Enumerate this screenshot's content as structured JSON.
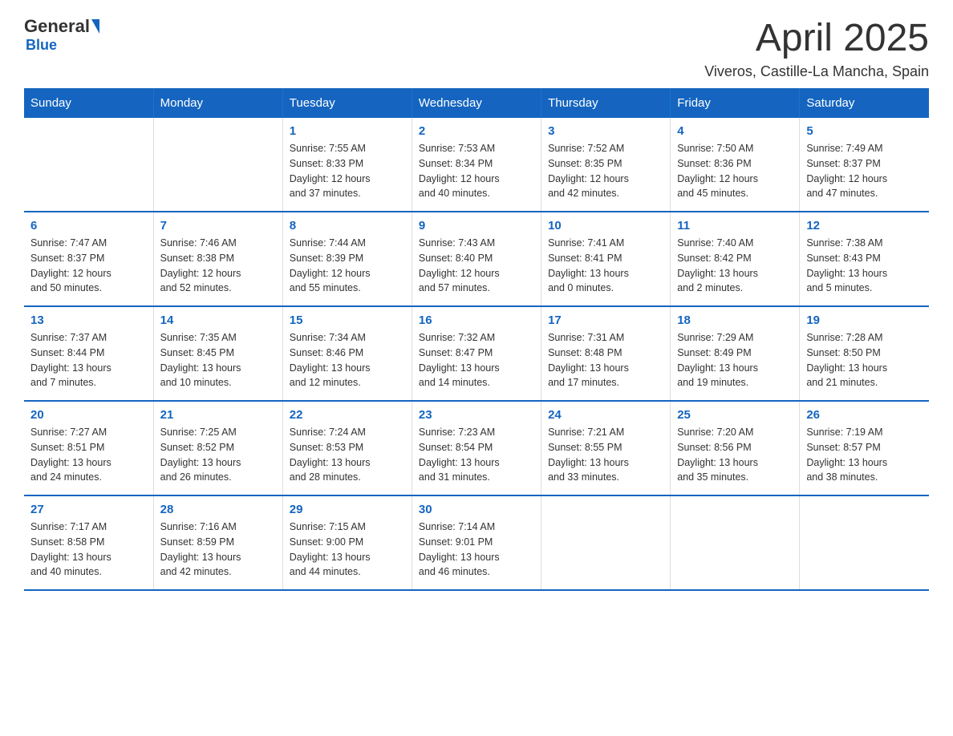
{
  "logo": {
    "general": "General",
    "blue": "Blue"
  },
  "title": "April 2025",
  "location": "Viveros, Castille-La Mancha, Spain",
  "days_of_week": [
    "Sunday",
    "Monday",
    "Tuesday",
    "Wednesday",
    "Thursday",
    "Friday",
    "Saturday"
  ],
  "weeks": [
    [
      {
        "day": "",
        "info": ""
      },
      {
        "day": "",
        "info": ""
      },
      {
        "day": "1",
        "info": "Sunrise: 7:55 AM\nSunset: 8:33 PM\nDaylight: 12 hours\nand 37 minutes."
      },
      {
        "day": "2",
        "info": "Sunrise: 7:53 AM\nSunset: 8:34 PM\nDaylight: 12 hours\nand 40 minutes."
      },
      {
        "day": "3",
        "info": "Sunrise: 7:52 AM\nSunset: 8:35 PM\nDaylight: 12 hours\nand 42 minutes."
      },
      {
        "day": "4",
        "info": "Sunrise: 7:50 AM\nSunset: 8:36 PM\nDaylight: 12 hours\nand 45 minutes."
      },
      {
        "day": "5",
        "info": "Sunrise: 7:49 AM\nSunset: 8:37 PM\nDaylight: 12 hours\nand 47 minutes."
      }
    ],
    [
      {
        "day": "6",
        "info": "Sunrise: 7:47 AM\nSunset: 8:37 PM\nDaylight: 12 hours\nand 50 minutes."
      },
      {
        "day": "7",
        "info": "Sunrise: 7:46 AM\nSunset: 8:38 PM\nDaylight: 12 hours\nand 52 minutes."
      },
      {
        "day": "8",
        "info": "Sunrise: 7:44 AM\nSunset: 8:39 PM\nDaylight: 12 hours\nand 55 minutes."
      },
      {
        "day": "9",
        "info": "Sunrise: 7:43 AM\nSunset: 8:40 PM\nDaylight: 12 hours\nand 57 minutes."
      },
      {
        "day": "10",
        "info": "Sunrise: 7:41 AM\nSunset: 8:41 PM\nDaylight: 13 hours\nand 0 minutes."
      },
      {
        "day": "11",
        "info": "Sunrise: 7:40 AM\nSunset: 8:42 PM\nDaylight: 13 hours\nand 2 minutes."
      },
      {
        "day": "12",
        "info": "Sunrise: 7:38 AM\nSunset: 8:43 PM\nDaylight: 13 hours\nand 5 minutes."
      }
    ],
    [
      {
        "day": "13",
        "info": "Sunrise: 7:37 AM\nSunset: 8:44 PM\nDaylight: 13 hours\nand 7 minutes."
      },
      {
        "day": "14",
        "info": "Sunrise: 7:35 AM\nSunset: 8:45 PM\nDaylight: 13 hours\nand 10 minutes."
      },
      {
        "day": "15",
        "info": "Sunrise: 7:34 AM\nSunset: 8:46 PM\nDaylight: 13 hours\nand 12 minutes."
      },
      {
        "day": "16",
        "info": "Sunrise: 7:32 AM\nSunset: 8:47 PM\nDaylight: 13 hours\nand 14 minutes."
      },
      {
        "day": "17",
        "info": "Sunrise: 7:31 AM\nSunset: 8:48 PM\nDaylight: 13 hours\nand 17 minutes."
      },
      {
        "day": "18",
        "info": "Sunrise: 7:29 AM\nSunset: 8:49 PM\nDaylight: 13 hours\nand 19 minutes."
      },
      {
        "day": "19",
        "info": "Sunrise: 7:28 AM\nSunset: 8:50 PM\nDaylight: 13 hours\nand 21 minutes."
      }
    ],
    [
      {
        "day": "20",
        "info": "Sunrise: 7:27 AM\nSunset: 8:51 PM\nDaylight: 13 hours\nand 24 minutes."
      },
      {
        "day": "21",
        "info": "Sunrise: 7:25 AM\nSunset: 8:52 PM\nDaylight: 13 hours\nand 26 minutes."
      },
      {
        "day": "22",
        "info": "Sunrise: 7:24 AM\nSunset: 8:53 PM\nDaylight: 13 hours\nand 28 minutes."
      },
      {
        "day": "23",
        "info": "Sunrise: 7:23 AM\nSunset: 8:54 PM\nDaylight: 13 hours\nand 31 minutes."
      },
      {
        "day": "24",
        "info": "Sunrise: 7:21 AM\nSunset: 8:55 PM\nDaylight: 13 hours\nand 33 minutes."
      },
      {
        "day": "25",
        "info": "Sunrise: 7:20 AM\nSunset: 8:56 PM\nDaylight: 13 hours\nand 35 minutes."
      },
      {
        "day": "26",
        "info": "Sunrise: 7:19 AM\nSunset: 8:57 PM\nDaylight: 13 hours\nand 38 minutes."
      }
    ],
    [
      {
        "day": "27",
        "info": "Sunrise: 7:17 AM\nSunset: 8:58 PM\nDaylight: 13 hours\nand 40 minutes."
      },
      {
        "day": "28",
        "info": "Sunrise: 7:16 AM\nSunset: 8:59 PM\nDaylight: 13 hours\nand 42 minutes."
      },
      {
        "day": "29",
        "info": "Sunrise: 7:15 AM\nSunset: 9:00 PM\nDaylight: 13 hours\nand 44 minutes."
      },
      {
        "day": "30",
        "info": "Sunrise: 7:14 AM\nSunset: 9:01 PM\nDaylight: 13 hours\nand 46 minutes."
      },
      {
        "day": "",
        "info": ""
      },
      {
        "day": "",
        "info": ""
      },
      {
        "day": "",
        "info": ""
      }
    ]
  ]
}
